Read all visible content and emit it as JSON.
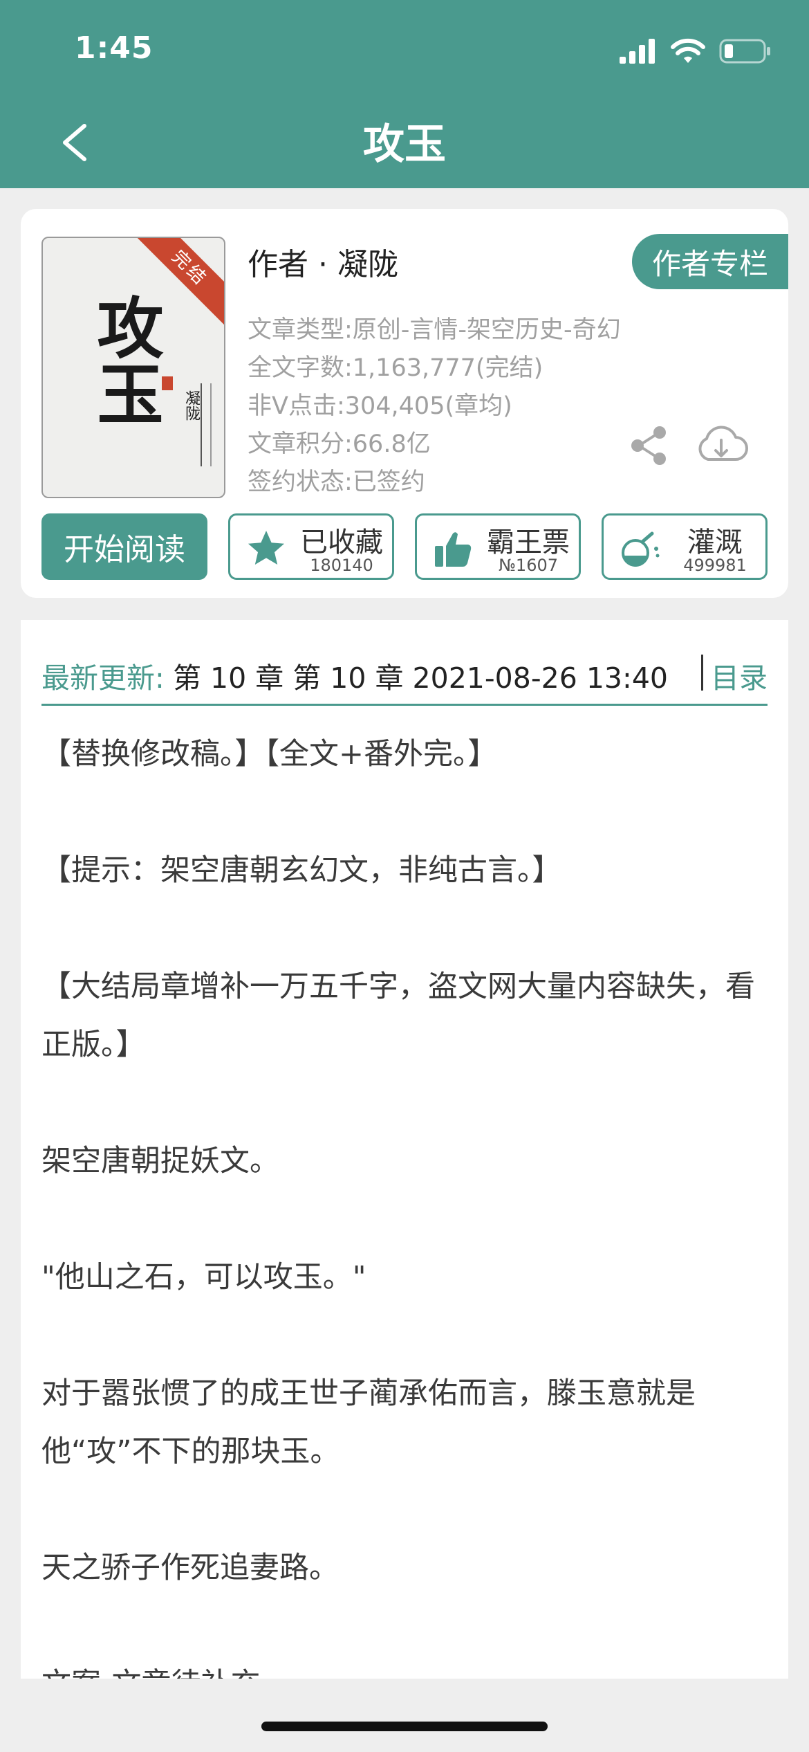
{
  "status_bar": {
    "time": "1:45"
  },
  "nav": {
    "title": "攻玉"
  },
  "book": {
    "cover": {
      "badge": "完结",
      "title": "攻玉",
      "author": "凝陇"
    },
    "author_line": "作者 · 凝陇",
    "author_column_button": "作者专栏",
    "meta": [
      "文章类型:原创-言情-架空历史-奇幻",
      "全文字数:1,163,777(完结)",
      "非V点击:304,405(章均)",
      "文章积分:66.8亿",
      "签约状态:已签约"
    ],
    "read_button": "开始阅读",
    "actions": [
      {
        "label": "已收藏",
        "count": "180140",
        "icon": "star-icon"
      },
      {
        "label": "霸王票",
        "count": "№1607",
        "icon": "thumbs-up-icon"
      },
      {
        "label": "灌溉",
        "count": "499981",
        "icon": "watering-flask-icon"
      }
    ]
  },
  "update": {
    "label": "最新更新:",
    "text": "第 10 章 第 10 章 2021-08-26 13:40",
    "toc": "目录"
  },
  "intro": [
    "【替换修改稿。】【全文+番外完。】",
    "【提示：架空唐朝玄幻文，非纯古言。】",
    "【大结局章增补一万五千字，盗文网大量内容缺失，看正版。】",
    "架空唐朝捉妖文。",
    "\"他山之石，可以攻玉。\"",
    "对于嚣张惯了的成王世子蔺承佑而言，滕玉意就是他“攻”不下的那块玉。",
    "天之骄子作死追妻路。",
    "文案-文章待补充"
  ],
  "colors": {
    "accent": "#4a9a8e",
    "ribbon": "#c9472f"
  }
}
